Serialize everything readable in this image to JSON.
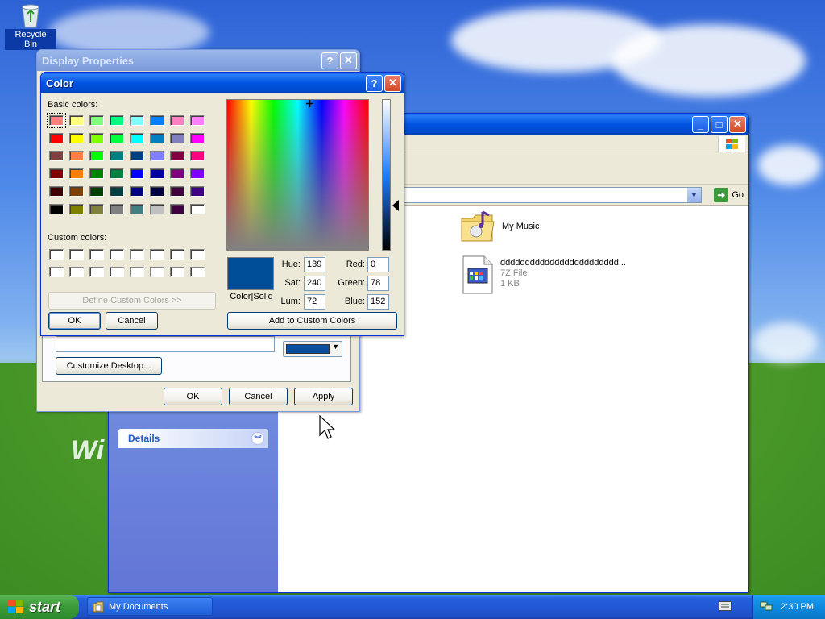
{
  "desktop": {
    "recycle_bin_label": "Recycle Bin",
    "wallpaper_text": "Wi"
  },
  "explorer": {
    "go_label": "Go",
    "details_label": "Details",
    "files": [
      {
        "name": "My Music",
        "type": "",
        "size": ""
      },
      {
        "name": "dddddddddddddddddddddddd...",
        "type": "7Z File",
        "size": "1 KB"
      }
    ]
  },
  "display_properties": {
    "title": "Display Properties",
    "customize_desktop_label": "Customize Desktop...",
    "ok_label": "OK",
    "cancel_label": "Cancel",
    "apply_label": "Apply",
    "color_button_color": "#0a4ea0"
  },
  "color_dialog": {
    "title": "Color",
    "basic_colors_label": "Basic colors:",
    "custom_colors_label": "Custom colors:",
    "define_custom_label": "Define Custom Colors >>",
    "ok_label": "OK",
    "cancel_label": "Cancel",
    "color_solid_label": "Color|Solid",
    "add_custom_label": "Add to Custom Colors",
    "selected_color": "#004e98",
    "hue_label": "Hue:",
    "hue": "139",
    "sat_label": "Sat:",
    "sat": "240",
    "lum_label": "Lum:",
    "lum": "72",
    "red_label": "Red:",
    "red": "0",
    "green_label": "Green:",
    "green": "78",
    "blue_label": "Blue:",
    "blue": "152",
    "basic_colors": [
      "#ff8080",
      "#ffff80",
      "#80ff80",
      "#00ff80",
      "#80ffff",
      "#0080ff",
      "#ff80c0",
      "#ff80ff",
      "#ff0000",
      "#ffff00",
      "#80ff00",
      "#00ff40",
      "#00ffff",
      "#0080c0",
      "#8080c0",
      "#ff00ff",
      "#804040",
      "#ff8040",
      "#00ff00",
      "#008080",
      "#004080",
      "#8080ff",
      "#800040",
      "#ff0080",
      "#800000",
      "#ff8000",
      "#008000",
      "#008040",
      "#0000ff",
      "#0000a0",
      "#800080",
      "#8000ff",
      "#400000",
      "#804000",
      "#004000",
      "#004040",
      "#000080",
      "#000040",
      "#400040",
      "#400080",
      "#000000",
      "#808000",
      "#808040",
      "#808080",
      "#408080",
      "#c0c0c0",
      "#400040",
      "#ffffff"
    ]
  },
  "taskbar": {
    "start_label": "start",
    "task_label": "My Documents",
    "clock": "2:30 PM"
  }
}
